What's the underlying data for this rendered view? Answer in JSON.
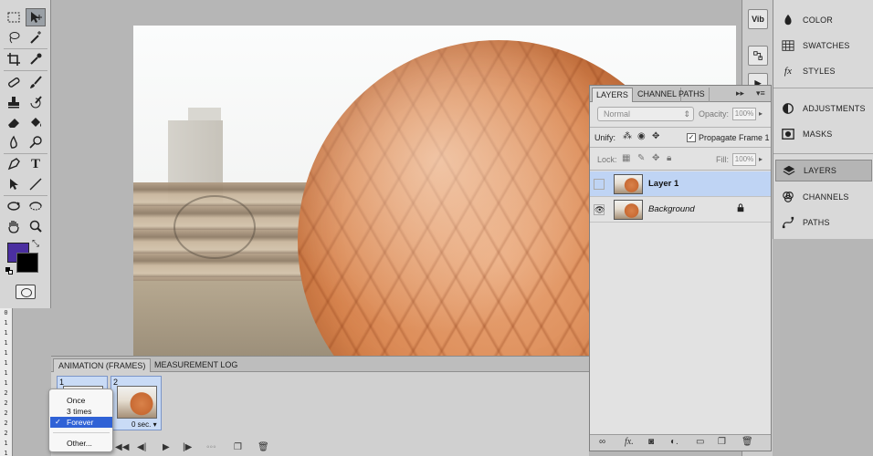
{
  "tools": {
    "icons": [
      "rectangular-marquee-icon",
      "move-icon",
      "lasso-icon",
      "magic-wand-icon",
      "crop-icon",
      "eyedropper-icon",
      "healing-brush-icon",
      "brush-icon",
      "clone-stamp-icon",
      "history-brush-icon",
      "eraser-icon",
      "paint-bucket-icon",
      "blur-icon",
      "dodge-icon",
      "pen-icon",
      "type-icon",
      "path-selection-icon",
      "line-icon",
      "3d-rotate-icon",
      "3d-orbit-icon",
      "hand-icon",
      "zoom-icon"
    ],
    "type_glyph": "T",
    "foreground_color": "#4b2fa0",
    "background_color": "#000000"
  },
  "ruler": {
    "marks": [
      "0",
      "1",
      "1",
      "1",
      "1",
      "1",
      "1",
      "1",
      "2",
      "2",
      "2",
      "2",
      "2",
      "1",
      "1"
    ]
  },
  "dock": {
    "buttons": [
      "Vib",
      "",
      "▶"
    ]
  },
  "right_panel": {
    "items": [
      {
        "label": "COLOR",
        "icon": "color-icon"
      },
      {
        "label": "SWATCHES",
        "icon": "swatches-icon"
      },
      {
        "label": "STYLES",
        "icon": "styles-icon"
      },
      {
        "label": "ADJUSTMENTS",
        "icon": "adjustments-icon"
      },
      {
        "label": "MASKS",
        "icon": "masks-icon"
      },
      {
        "label": "LAYERS",
        "icon": "layers-icon",
        "active": true
      },
      {
        "label": "CHANNELS",
        "icon": "channels-icon"
      },
      {
        "label": "PATHS",
        "icon": "paths-icon"
      }
    ]
  },
  "layers_panel": {
    "tabs": [
      "LAYERS",
      "CHANNEL",
      "PATHS"
    ],
    "blend_mode": "Normal",
    "opacity_label": "Opacity:",
    "opacity_value": "100%",
    "unify_label": "Unify:",
    "propagate_label": "Propagate Frame 1",
    "lock_label": "Lock:",
    "fill_label": "Fill:",
    "fill_value": "100%",
    "layers": [
      {
        "name": "Layer 1",
        "selected": true,
        "visible": false
      },
      {
        "name": "Background",
        "selected": false,
        "visible": true,
        "locked": true
      }
    ],
    "footer_icons": [
      "link-layers-icon",
      "fx-icon",
      "layer-mask-icon",
      "adjustment-layer-icon",
      "new-group-icon",
      "new-layer-icon",
      "trash-icon"
    ]
  },
  "animation_panel": {
    "tabs": [
      "ANIMATION (FRAMES)",
      "MEASUREMENT LOG"
    ],
    "frames": [
      {
        "number": "1",
        "delay": ""
      },
      {
        "number": "2",
        "delay": "0 sec."
      }
    ]
  },
  "loop_menu": {
    "options": [
      "Once",
      "3 times",
      "Forever",
      "Other..."
    ],
    "selected": "Forever"
  }
}
